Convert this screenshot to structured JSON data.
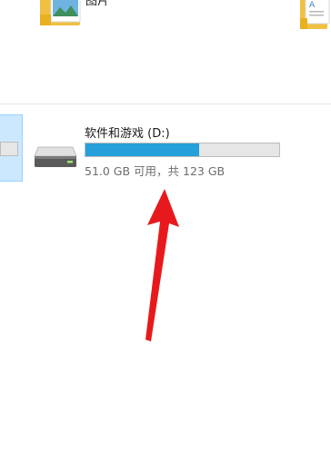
{
  "folders": [
    {
      "name": "pictures",
      "label": "图片",
      "icon": "picture-folder-icon"
    },
    {
      "name": "documents",
      "label": "",
      "icon": "document-folder-icon"
    }
  ],
  "drive": {
    "title": "软件和游戏 (D:)",
    "free_text": "51.0 GB 可用，共 123 GB",
    "used_fraction": 0.585,
    "icon": "hard-drive-icon",
    "bar_color": "#26a0da"
  },
  "annotation": {
    "icon": "red-arrow-icon",
    "color": "#e8191c"
  }
}
